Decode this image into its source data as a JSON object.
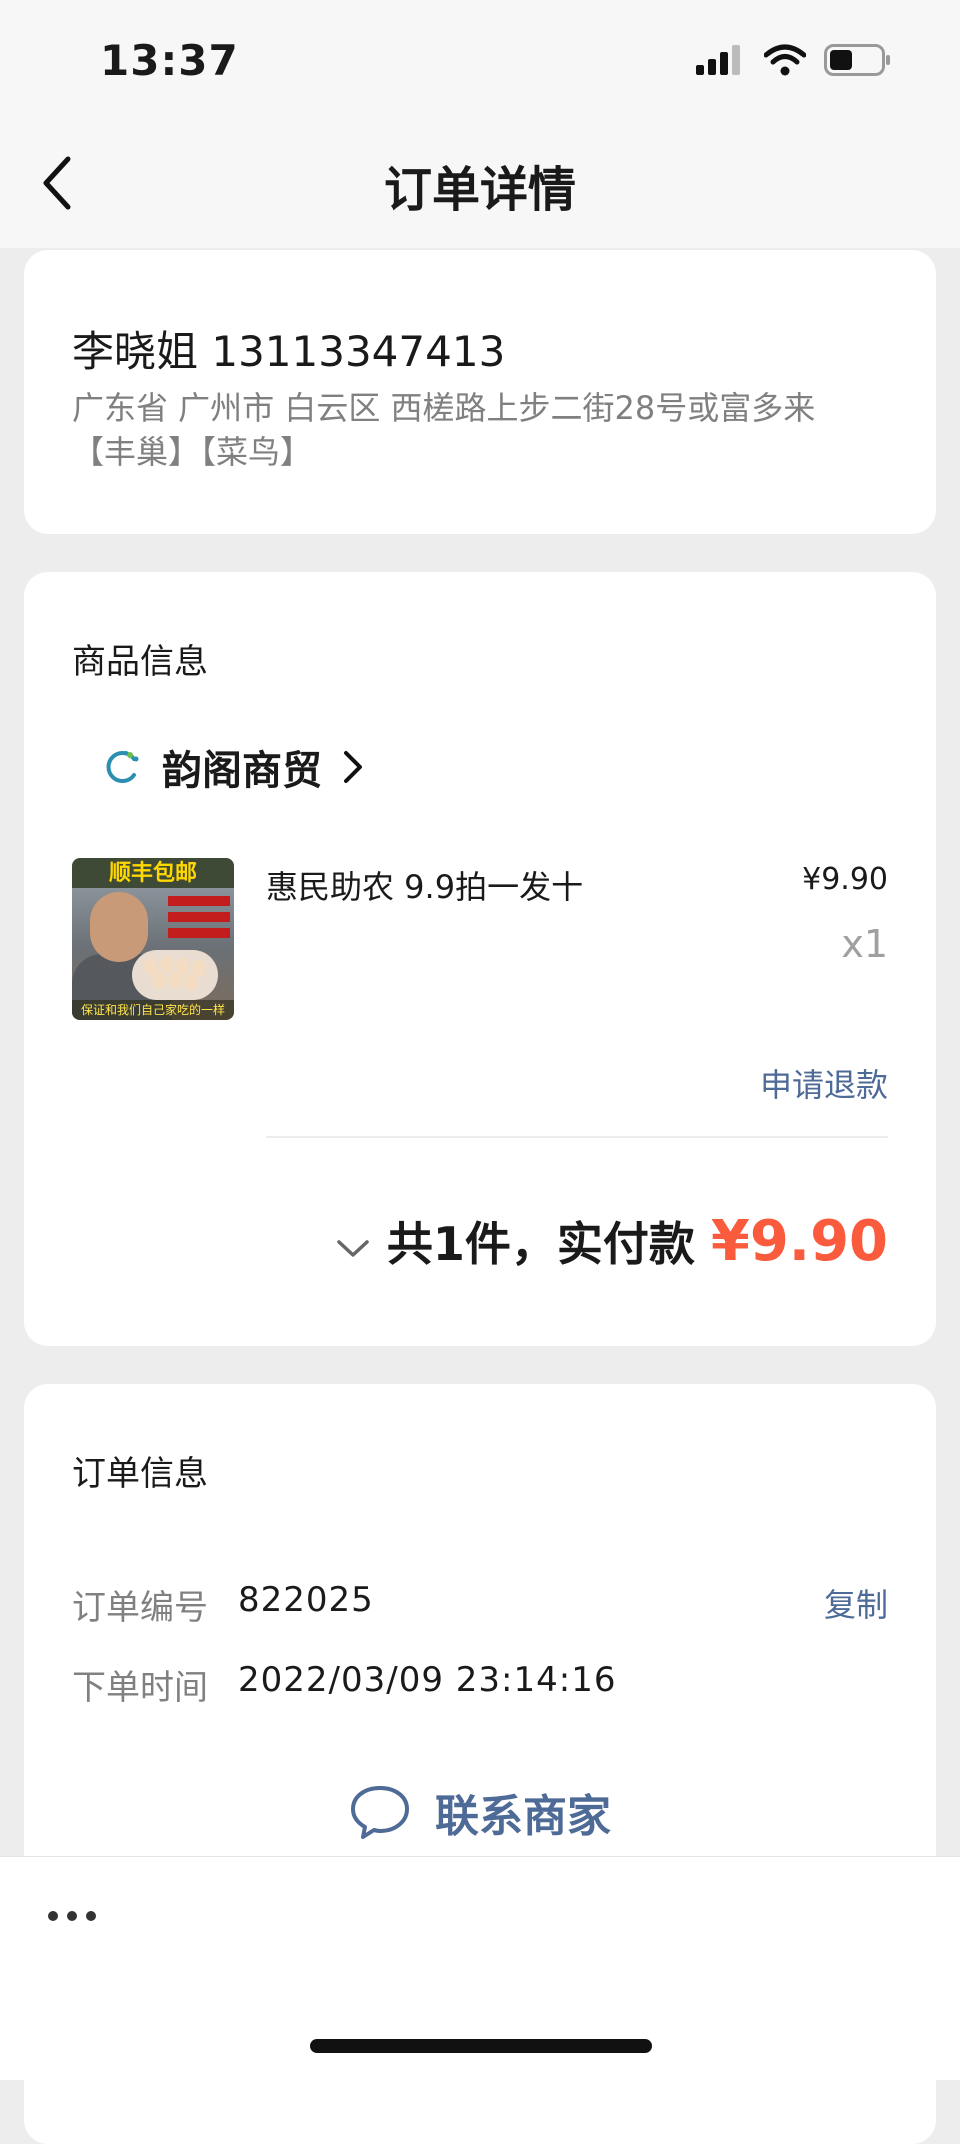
{
  "status_bar": {
    "time": "13:37",
    "battery_level": 0.45
  },
  "nav": {
    "title": "订单详情"
  },
  "address": {
    "name_phone": "李晓姐 13113347413",
    "line1": "广东省 广州市 白云区 西槎路上步二街28号或富多来",
    "line2": "【丰巢】【菜鸟】"
  },
  "goods": {
    "section_title": "商品信息",
    "shop_name": "韵阁商贸",
    "item": {
      "banner_text": "顺丰包邮",
      "footer_text": "保证和我们自己家吃的一样",
      "title": "惠民助农 9.9拍一发十",
      "price": "¥9.90",
      "qty": "x1"
    },
    "refund_label": "申请退款",
    "total_label": "共1件，实付款",
    "total_amount": "¥9.90"
  },
  "order": {
    "section_title": "订单信息",
    "number_label": "订单编号",
    "number_value": "822025",
    "copy_label": "复制",
    "time_label": "下单时间",
    "time_value": "2022/03/09 23:14:16",
    "contact_label": "联系商家"
  },
  "colors": {
    "accent_blue": "#4e6a97",
    "price_red": "#fa5b3c",
    "background": "#ededed"
  },
  "icons": {
    "back": "chevron-left-icon",
    "shop_logo": "shop-logo-icon",
    "shop_arrow": "chevron-right-icon",
    "expand": "chevron-down-icon",
    "contact": "chat-bubble-icon",
    "more": "more-dots-icon"
  }
}
